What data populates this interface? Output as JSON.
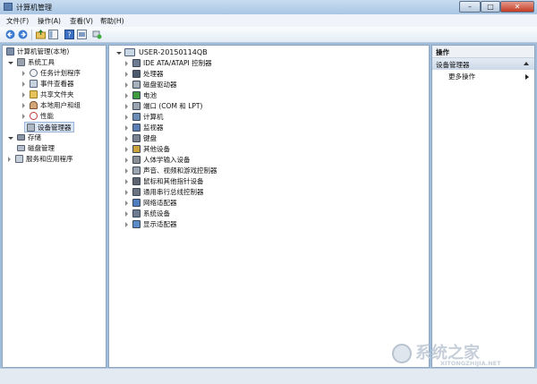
{
  "window": {
    "title": "计算机管理",
    "controls": {
      "minimize": "–",
      "maximize": "□",
      "close": "✕"
    }
  },
  "menu": [
    "文件(F)",
    "操作(A)",
    "查看(V)",
    "帮助(H)"
  ],
  "toolbar_icons": [
    "back-arrow-icon",
    "forward-arrow-icon",
    "up-folder-icon",
    "show-tree-icon",
    "help-icon",
    "properties-icon",
    "refresh-icon"
  ],
  "left_tree": [
    {
      "label": "计算机管理(本地)",
      "icon": "computer-management-icon"
    },
    {
      "label": "系统工具",
      "icon": "tools-icon"
    },
    {
      "label": "任务计划程序",
      "icon": "clock-icon"
    },
    {
      "label": "事件查看器",
      "icon": "event-viewer-icon"
    },
    {
      "label": "共享文件夹",
      "icon": "shared-folder-icon"
    },
    {
      "label": "本地用户和组",
      "icon": "users-icon"
    },
    {
      "label": "性能",
      "icon": "performance-icon"
    },
    {
      "label": "设备管理器",
      "icon": "device-manager-icon"
    },
    {
      "label": "存储",
      "icon": "storage-icon"
    },
    {
      "label": "磁盘管理",
      "icon": "disk-management-icon"
    },
    {
      "label": "服务和应用程序",
      "icon": "services-icon"
    }
  ],
  "device_tree": {
    "root": "USER-20150114QB",
    "categories": [
      {
        "label": "IDE ATA/ATAPI 控制器",
        "icon": "ide-controller-icon"
      },
      {
        "label": "处理器",
        "icon": "processor-icon"
      },
      {
        "label": "磁盘驱动器",
        "icon": "disk-drive-icon"
      },
      {
        "label": "电池",
        "icon": "battery-icon"
      },
      {
        "label": "端口 (COM 和 LPT)",
        "icon": "port-icon"
      },
      {
        "label": "计算机",
        "icon": "computer-icon"
      },
      {
        "label": "监视器",
        "icon": "monitor-icon"
      },
      {
        "label": "键盘",
        "icon": "keyboard-icon"
      },
      {
        "label": "其他设备",
        "icon": "other-devices-icon"
      },
      {
        "label": "人体学输入设备",
        "icon": "hid-icon"
      },
      {
        "label": "声音、视频和游戏控制器",
        "icon": "sound-icon"
      },
      {
        "label": "鼠标和其他指针设备",
        "icon": "mouse-icon"
      },
      {
        "label": "通用串行总线控制器",
        "icon": "usb-icon"
      },
      {
        "label": "网络适配器",
        "icon": "network-adapter-icon"
      },
      {
        "label": "系统设备",
        "icon": "system-devices-icon"
      },
      {
        "label": "显示适配器",
        "icon": "display-adapter-icon"
      }
    ]
  },
  "actions": {
    "header": "操作",
    "section": "设备管理器",
    "more": "更多操作"
  },
  "watermark": {
    "text": "系统之家",
    "url": "XITONGZHIJIA.NET"
  }
}
